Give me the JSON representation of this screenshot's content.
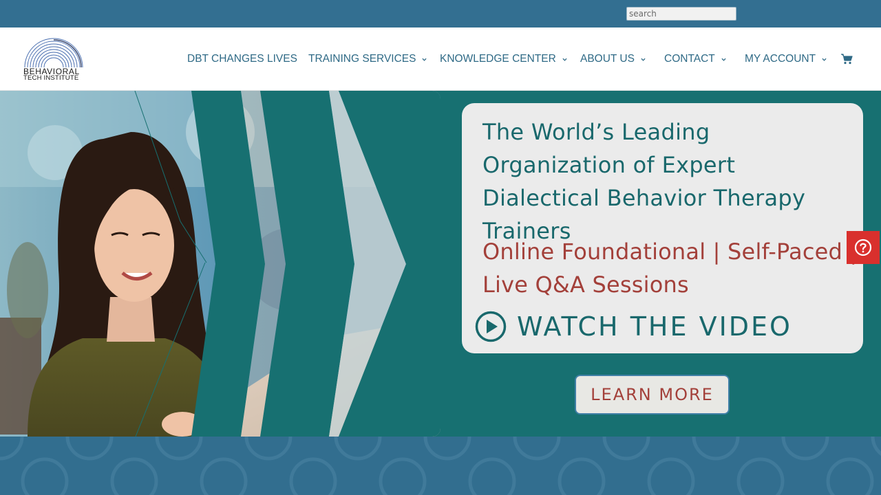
{
  "topbar": {
    "search_placeholder": "search"
  },
  "logo": {
    "line1": "BEHAVIORAL",
    "line2": "TECH INSTITUTE"
  },
  "nav": {
    "items": [
      {
        "label": "DBT CHANGES LIVES",
        "has_dropdown": false
      },
      {
        "label": "TRAINING SERVICES",
        "has_dropdown": true
      },
      {
        "label": "KNOWLEDGE CENTER",
        "has_dropdown": true
      },
      {
        "label": "ABOUT US",
        "has_dropdown": true
      },
      {
        "label": "CONTACT",
        "has_dropdown": true
      },
      {
        "label": "MY ACCOUNT",
        "has_dropdown": true
      }
    ],
    "cart_icon": "shopping-cart-icon"
  },
  "hero": {
    "title": "The World’s Leading Organization of Expert Dialectical Behavior Therapy Trainers",
    "subtitle": "Online Foundational | Self-Paced | Live Q&A Sessions",
    "watch_label": "WATCH THE VIDEO",
    "watch_icon": "play-circle-icon",
    "learn_more_label": "LEARN MORE"
  },
  "help": {
    "icon": "question-circle-icon"
  },
  "colors": {
    "topbar": "#336f91",
    "nav_text": "#2f6a86",
    "hero_teal": "#177071",
    "title_teal": "#19686c",
    "subtitle_red": "#a3403a",
    "help_red": "#d9302d",
    "card_bg": "#ebebeb"
  }
}
